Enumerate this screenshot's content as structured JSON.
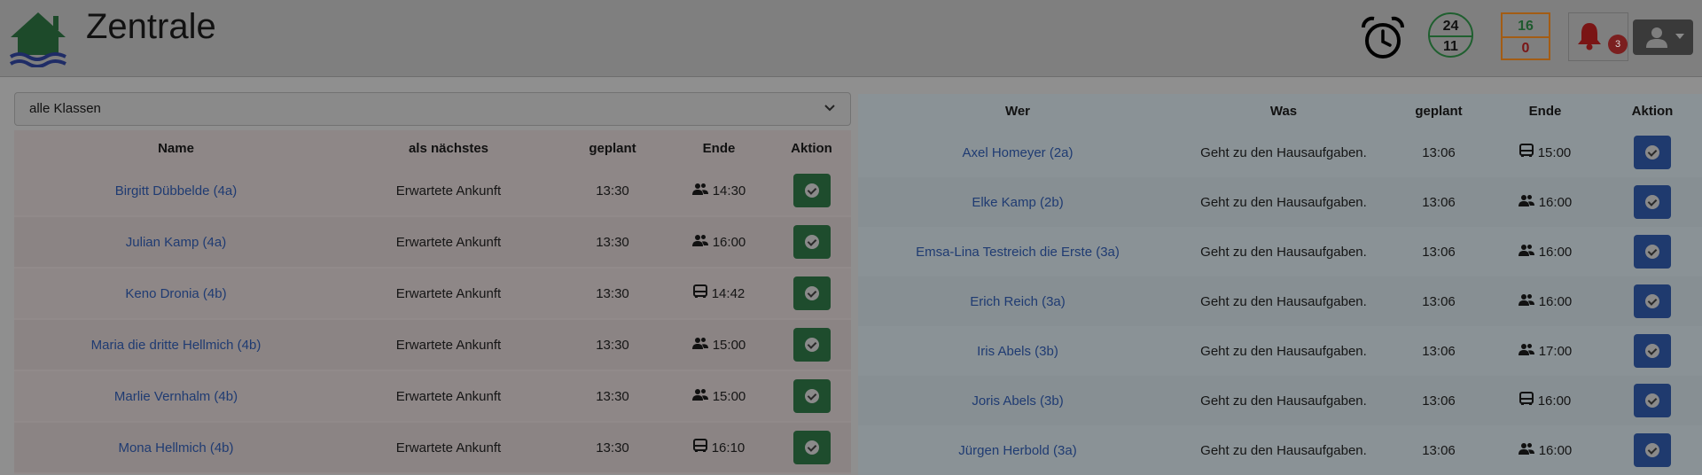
{
  "app": {
    "title": "Zentrale"
  },
  "header": {
    "circle_counter": {
      "top": "24",
      "bottom": "11"
    },
    "square_counter": {
      "top": "16",
      "bottom": "0"
    },
    "notifications": {
      "count": "3"
    }
  },
  "filter": {
    "selected": "alle Klassen"
  },
  "left_table": {
    "headers": {
      "name": "Name",
      "next": "als nächstes",
      "planned": "geplant",
      "end": "Ende",
      "action": "Aktion"
    },
    "rows": [
      {
        "name": "Birgitt Dübbelde (4a)",
        "next": "Erwartete Ankunft",
        "planned": "13:30",
        "end_icon": "people-icon",
        "end": "14:30"
      },
      {
        "name": "Julian Kamp (4a)",
        "next": "Erwartete Ankunft",
        "planned": "13:30",
        "end_icon": "people-icon",
        "end": "16:00"
      },
      {
        "name": "Keno Dronia (4b)",
        "next": "Erwartete Ankunft",
        "planned": "13:30",
        "end_icon": "bus-icon",
        "end": "14:42"
      },
      {
        "name": "Maria die dritte Hellmich (4b)",
        "next": "Erwartete Ankunft",
        "planned": "13:30",
        "end_icon": "people-icon",
        "end": "15:00"
      },
      {
        "name": "Marlie Vernhalm (4b)",
        "next": "Erwartete Ankunft",
        "planned": "13:30",
        "end_icon": "people-icon",
        "end": "15:00"
      },
      {
        "name": "Mona Hellmich (4b)",
        "next": "Erwartete Ankunft",
        "planned": "13:30",
        "end_icon": "bus-icon",
        "end": "16:10"
      }
    ]
  },
  "right_table": {
    "headers": {
      "who": "Wer",
      "what": "Was",
      "planned": "geplant",
      "end": "Ende",
      "action": "Aktion"
    },
    "rows": [
      {
        "who": "Axel Homeyer (2a)",
        "what": "Geht zu den Hausaufgaben.",
        "planned": "13:06",
        "end_icon": "bus-icon",
        "end": "15:00"
      },
      {
        "who": "Elke Kamp (2b)",
        "what": "Geht zu den Hausaufgaben.",
        "planned": "13:06",
        "end_icon": "people-icon",
        "end": "16:00"
      },
      {
        "who": "Emsa-Lina Testreich die Erste (3a)",
        "what": "Geht zu den Hausaufgaben.",
        "planned": "13:06",
        "end_icon": "people-icon",
        "end": "16:00"
      },
      {
        "who": "Erich Reich (3a)",
        "what": "Geht zu den Hausaufgaben.",
        "planned": "13:06",
        "end_icon": "people-icon",
        "end": "16:00"
      },
      {
        "who": "Iris Abels (3b)",
        "what": "Geht zu den Hausaufgaben.",
        "planned": "13:06",
        "end_icon": "people-icon",
        "end": "17:00"
      },
      {
        "who": "Joris Abels (3b)",
        "what": "Geht zu den Hausaufgaben.",
        "planned": "13:06",
        "end_icon": "bus-icon",
        "end": "16:00"
      },
      {
        "who": "Jürgen Herbold (3a)",
        "what": "Geht zu den Hausaufgaben.",
        "planned": "13:06",
        "end_icon": "people-icon",
        "end": "16:00"
      }
    ]
  },
  "colors": {
    "accent_green": "#1e4c2d",
    "accent_blue": "#1f3a6e",
    "link": "#1f3b72"
  }
}
